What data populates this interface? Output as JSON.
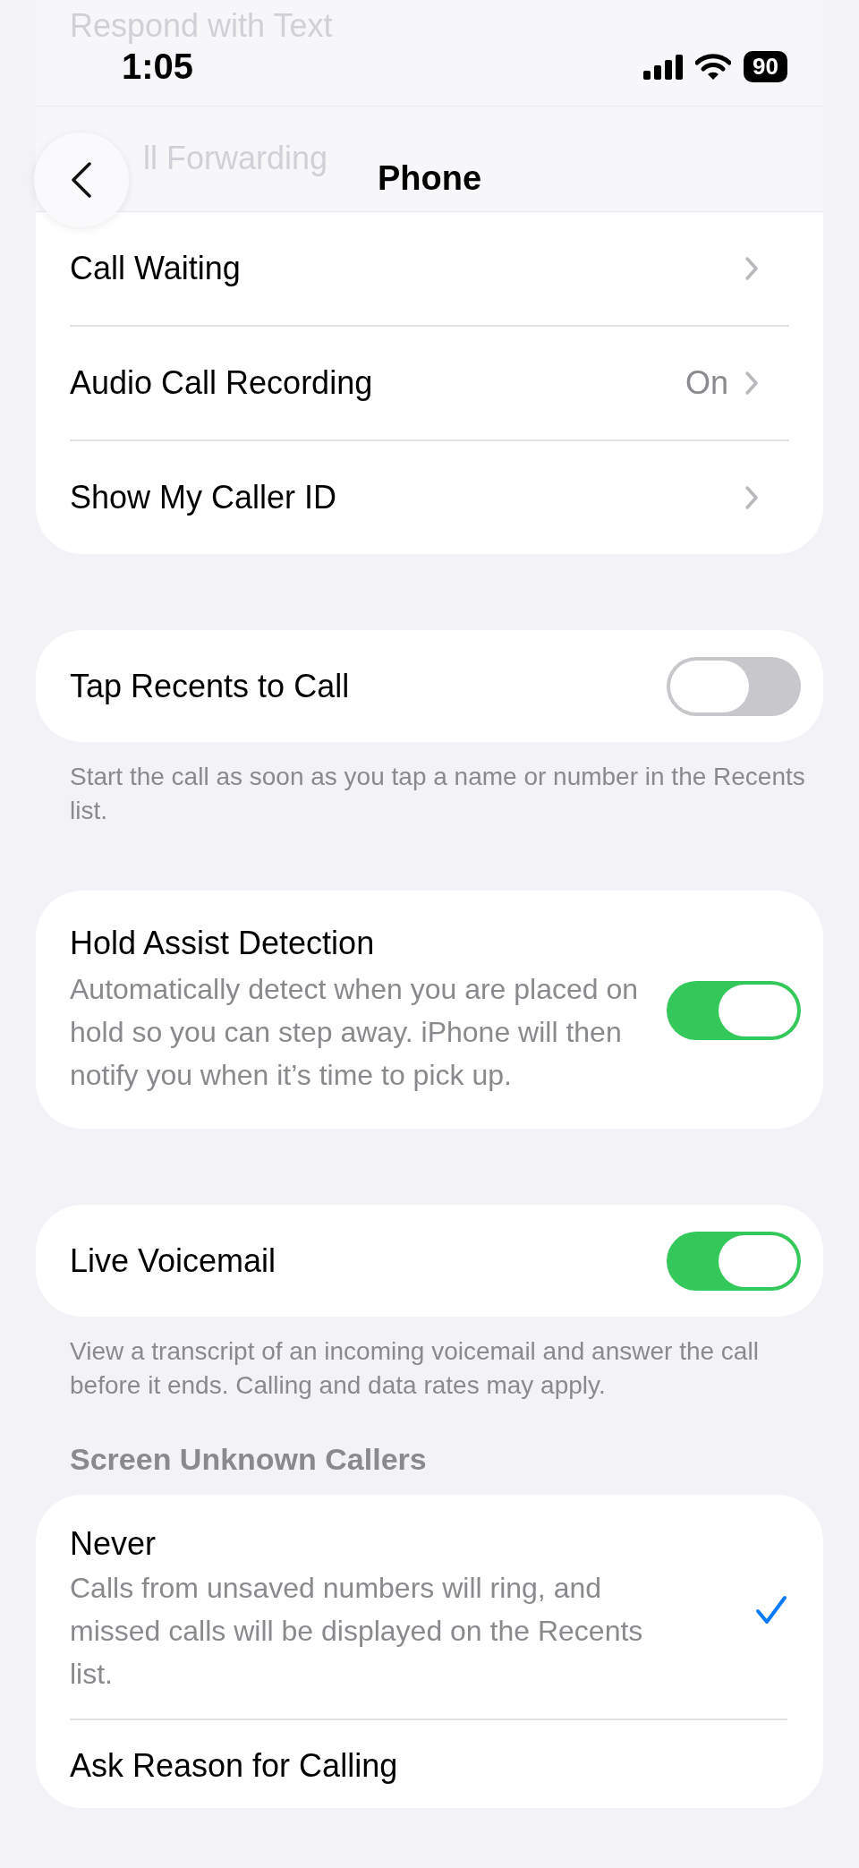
{
  "status_bar": {
    "time": "1:05",
    "battery": "90"
  },
  "nav": {
    "title": "Phone"
  },
  "background_rows": [
    {
      "label": "Respond with Text"
    },
    {
      "label": "ll Forwarding"
    }
  ],
  "call_settings": [
    {
      "label": "Call Waiting"
    },
    {
      "label": "Audio Call Recording",
      "value": "On"
    },
    {
      "label": "Show My Caller ID"
    }
  ],
  "tap_recents": {
    "label": "Tap Recents to Call",
    "on": false,
    "footer": "Start the call as soon as you tap a name or number in the Recents list."
  },
  "hold_assist": {
    "label": "Hold Assist Detection",
    "description": "Automatically detect when you are placed on hold so you can step away. iPhone will then notify you when it’s time to pick up.",
    "on": true
  },
  "live_voicemail": {
    "label": "Live Voicemail",
    "on": true,
    "footer": "View a transcript of an incoming voicemail and answer the call before it ends. Calling and data rates may apply."
  },
  "screen_unknown": {
    "header": "Screen Unknown Callers",
    "options": [
      {
        "label": "Never",
        "description": "Calls from unsaved numbers will ring, and missed calls will be displayed on the Recents list.",
        "selected": true
      },
      {
        "label": "Ask Reason for Calling",
        "selected": false
      }
    ]
  }
}
